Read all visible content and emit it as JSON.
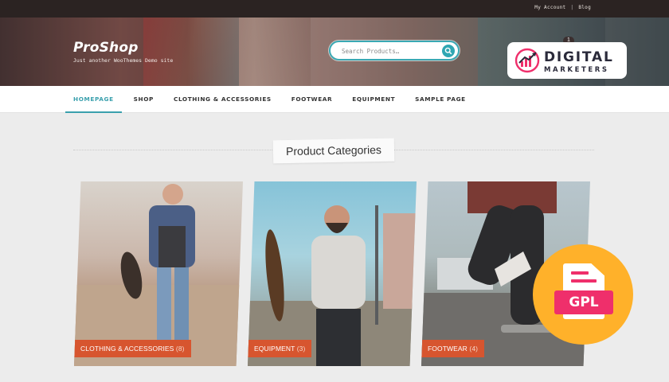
{
  "topbar": {
    "my_account": "My Account",
    "separator": "|",
    "blog": "Blog"
  },
  "brand": {
    "name": "ProShop",
    "tagline": "Just another WooThemes Demo site"
  },
  "search": {
    "placeholder": "Search Products…",
    "icon": "search-icon"
  },
  "cart": {
    "count": "1"
  },
  "overlay_logo": {
    "line1": "DIGITAL",
    "line2": "MARKETERS",
    "colors": [
      "#ef2f6b",
      "#2a2a3a"
    ]
  },
  "nav": {
    "items": [
      {
        "label": "HOMEPAGE",
        "active": true
      },
      {
        "label": "SHOP"
      },
      {
        "label": "CLOTHING & ACCESSORIES"
      },
      {
        "label": "FOOTWEAR"
      },
      {
        "label": "EQUIPMENT"
      },
      {
        "label": "SAMPLE PAGE"
      }
    ]
  },
  "section": {
    "title": "Product Categories"
  },
  "categories": [
    {
      "name": "CLOTHING & ACCESSORIES",
      "count": "(8)"
    },
    {
      "name": "EQUIPMENT",
      "count": "(3)"
    },
    {
      "name": "FOOTWEAR",
      "count": "(4)"
    }
  ],
  "gpl_badge": {
    "label": "GPL",
    "icon": "document-icon",
    "colors": [
      "#ffb12a",
      "#ef2f6b"
    ]
  },
  "accent": {
    "teal": "#3aa0ad",
    "orange": "#d7552f"
  }
}
